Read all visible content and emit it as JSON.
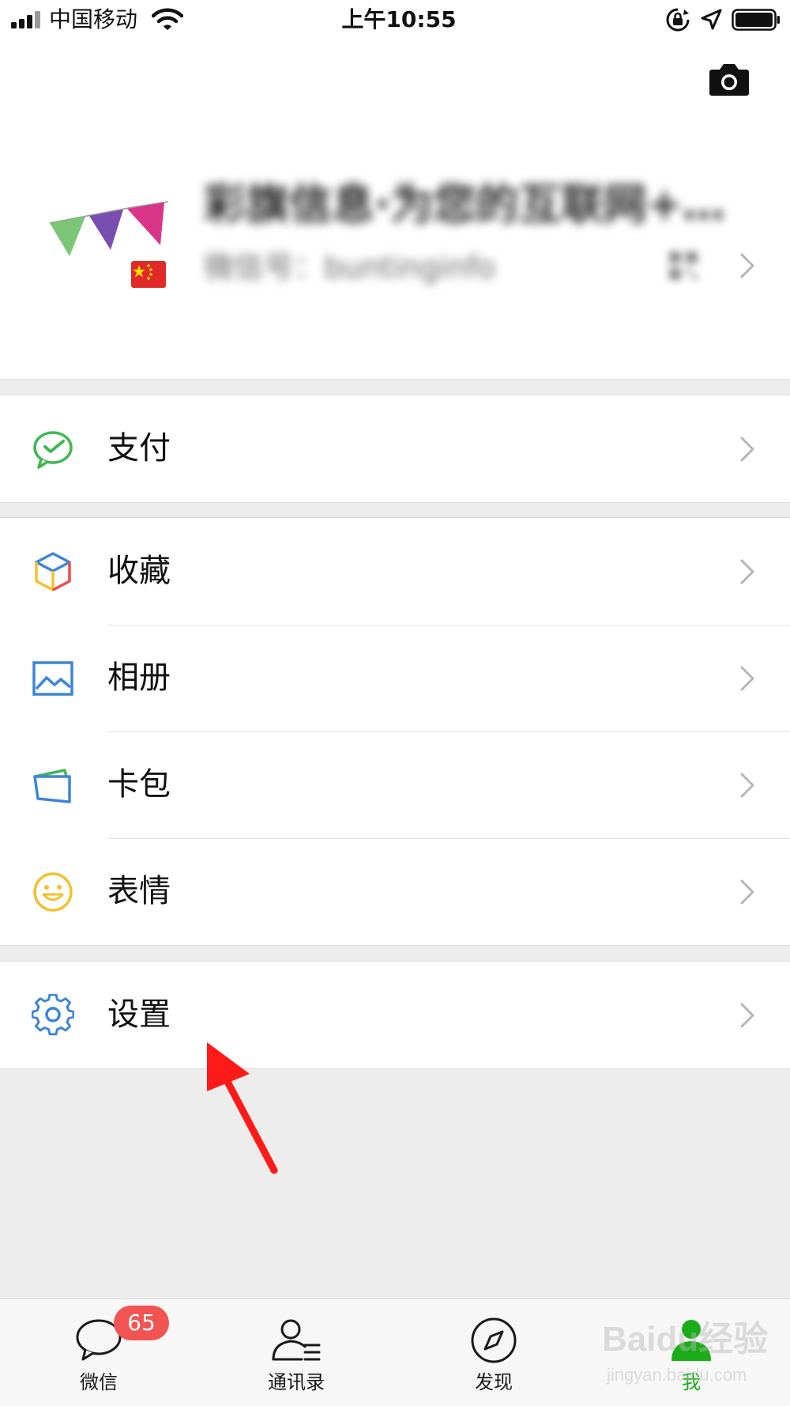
{
  "status_bar": {
    "carrier": "中国移动",
    "time": "上午10:55",
    "icons": [
      "signal-icon",
      "wifi-icon",
      "rotation-lock-icon",
      "location-icon",
      "battery-icon"
    ]
  },
  "profile": {
    "name": "彩旗信息·为您的互联网+…",
    "wechat_id": "微信号：buntinginfo",
    "icons": [
      "camera-icon",
      "avatar-flags",
      "china-flag-icon",
      "qr-code-icon",
      "chevron-right-icon"
    ]
  },
  "menu": {
    "pay": {
      "label": "支付",
      "icon": "wechat-pay-icon",
      "color": "#3fb850"
    },
    "favorites": {
      "label": "收藏",
      "icon": "cube-icon"
    },
    "album": {
      "label": "相册",
      "icon": "picture-icon",
      "color": "#3d86d6"
    },
    "cards": {
      "label": "卡包",
      "icon": "card-wallet-icon",
      "color": "#3d86d6"
    },
    "stickers": {
      "label": "表情",
      "icon": "smiley-icon",
      "color": "#f5c02f"
    },
    "settings": {
      "label": "设置",
      "icon": "gear-icon",
      "color": "#3d86d6"
    }
  },
  "tabbar": {
    "chats": {
      "label": "微信",
      "badge": "65",
      "icon": "chat-bubble-icon"
    },
    "contacts": {
      "label": "通讯录",
      "icon": "contacts-icon"
    },
    "discover": {
      "label": "发现",
      "icon": "compass-icon"
    },
    "me": {
      "label": "我",
      "icon": "person-icon",
      "active": true
    }
  },
  "watermark": {
    "brand": "Baidu经验",
    "url": "jingyan.baidu.com"
  },
  "colors": {
    "accent_green": "#1aad19",
    "badge_red": "#f25353",
    "annotation_arrow": "#ff1a1a",
    "background": "#ededed"
  }
}
